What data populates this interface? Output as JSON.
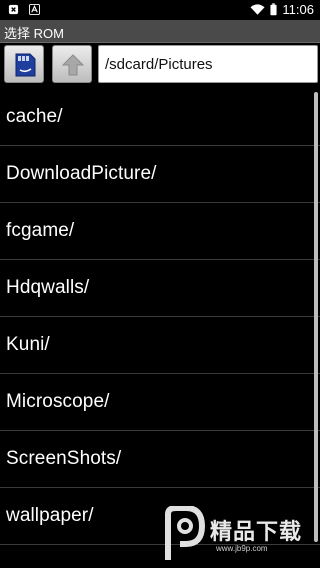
{
  "status_bar": {
    "time": "11:06"
  },
  "title_bar": {
    "title": "选择 ROM"
  },
  "toolbar": {
    "path_value": "/sdcard/Pictures"
  },
  "files": [
    {
      "label": "cache/"
    },
    {
      "label": "DownloadPicture/"
    },
    {
      "label": "fcgame/"
    },
    {
      "label": "Hdqwalls/"
    },
    {
      "label": "Kuni/"
    },
    {
      "label": "Microscope/"
    },
    {
      "label": "ScreenShots/"
    },
    {
      "label": "wallpaper/"
    }
  ],
  "watermark": {
    "text": "精品下载",
    "url": "www.jb9p.com"
  },
  "colors": {
    "background": "#000000",
    "title_bar": "#4a4a4a",
    "text": "#ffffff",
    "divider": "#3a3a3a"
  },
  "icons": [
    "close-notification-icon",
    "a-notification-icon",
    "wifi-icon",
    "battery-icon",
    "sd-card-icon",
    "up-arrow-icon"
  ]
}
